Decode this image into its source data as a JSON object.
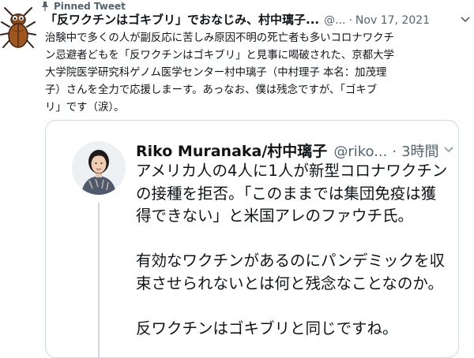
{
  "pinned": {
    "label": "Pinned Tweet",
    "icon": "pin-icon"
  },
  "tweet": {
    "author_name": "「反ワクチンはゴキブリ」でおなじみ、村中璃子...",
    "handle": "@...",
    "separator": "·",
    "date": "Nov 17, 2021",
    "text_lines": [
      "治験中で多くの人が副反応に苦しみ原因不明の死亡者も多いコロナワクチ",
      "ン忌避者どもを「反ワクチンはゴキブリ」と見事に喝破された、京都大学",
      "大学院医学研究科ゲノム医学センター村中璃子（中村理子 本名：加茂理",
      "子）さんを全力で応援しまーす。あっなお、僕は残念ですが、「ゴキブ",
      "リ」です（涙）。"
    ]
  },
  "quoted": {
    "author_name": "Riko Muranaka/村中璃子",
    "handle": "@riko...",
    "separator": "·",
    "time": "3時間",
    "lines": [
      "アメリカ人の4人に1人が新型コロナワクチン",
      "の接種を拒否。「このままでは集団免疫は獲",
      "得できない」と米国アレのファウチ氏。",
      "",
      "有効なワクチンがあるのにパンデミックを収",
      "束させられないとは何と残念なことなのか。",
      "",
      "反ワクチンはゴキブリと同じですね。"
    ]
  },
  "colors": {
    "text": "#0f1419",
    "secondary": "#536471",
    "border": "#cfd9de"
  }
}
